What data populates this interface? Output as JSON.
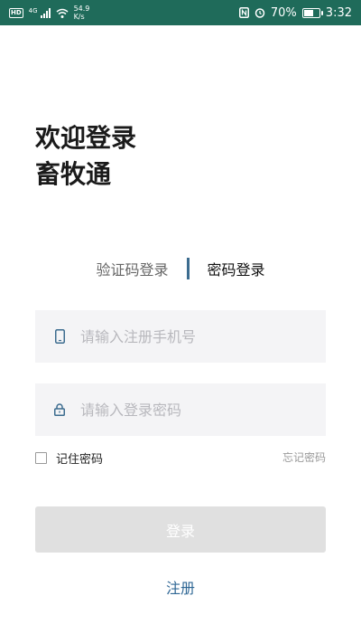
{
  "status_bar": {
    "badge": "HD",
    "network_type": "4G",
    "speed_value": "54.9",
    "speed_unit": "K/s",
    "battery_percent": "70%",
    "battery_level": 0.7,
    "time": "3:32",
    "icons": [
      "signal-icon",
      "wifi-icon",
      "nfc-icon",
      "alarm-icon",
      "battery-icon"
    ],
    "color": "#1f6b5a"
  },
  "header": {
    "line1": "欢迎登录",
    "line2": "畜牧通"
  },
  "tabs": {
    "sms_login": "验证码登录",
    "password_login": "密码登录",
    "active": "password_login",
    "divider_color": "#3c6c8f"
  },
  "form": {
    "phone_placeholder": "请输入注册手机号",
    "password_placeholder": "请输入登录密码",
    "phone_icon": "phone-icon",
    "lock_icon": "lock-icon",
    "remember_label": "记住密码",
    "remember_checked": false,
    "forgot_label": "忘记密码",
    "login_label": "登录",
    "register_label": "注册",
    "accent_color": "#2f6795"
  }
}
